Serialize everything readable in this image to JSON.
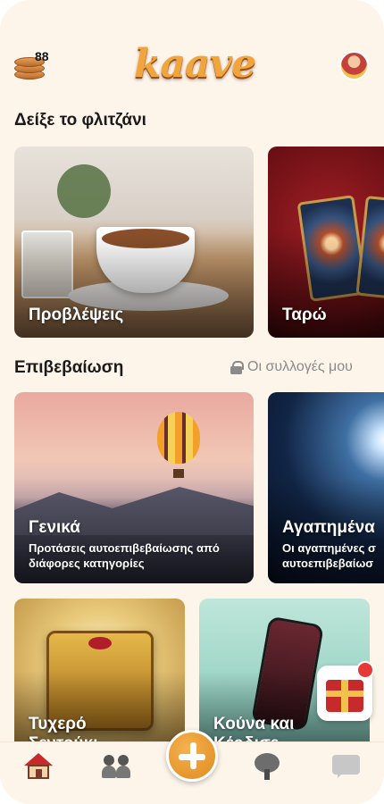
{
  "header": {
    "coin_count": "88",
    "logo_text": "kaave",
    "coins_icon": "coins-icon",
    "avatar_icon": "avatar"
  },
  "sections": {
    "cup_title": "Δείξε το φλιτζάνι",
    "affirm_title": "Επιβεβαίωση",
    "collections_link": "Οι συλλογές μου"
  },
  "cards": {
    "predictions": {
      "title": "Προβλέψεις"
    },
    "tarot": {
      "title": "Ταρώ"
    },
    "general": {
      "title": "Γενικά",
      "subtitle_line1": "Προτάσεις αυτοεπιβεβαίωσης από",
      "subtitle_line2": "διάφορες κατηγορίες"
    },
    "favorites": {
      "title": "Αγαπημένα",
      "subtitle_line1": "Οι αγαπημένες σ",
      "subtitle_line2": "αυτοεπιβεβαίωσ"
    },
    "lucky": {
      "title_line1": "Τυχερό",
      "title_line2": "Σεντούκι"
    },
    "coins_codes": {
      "title_line1": "Κούνα και",
      "title_line2": "Κέρδισε"
    }
  },
  "nav": {
    "items": [
      "home-icon",
      "people-icon",
      "plus-button",
      "tree-icon",
      "chat-icon"
    ]
  },
  "colors": {
    "background": "#fdf4ea",
    "accent": "#e08a1f",
    "text": "#1a1a1a",
    "muted": "#8a8a8a"
  }
}
